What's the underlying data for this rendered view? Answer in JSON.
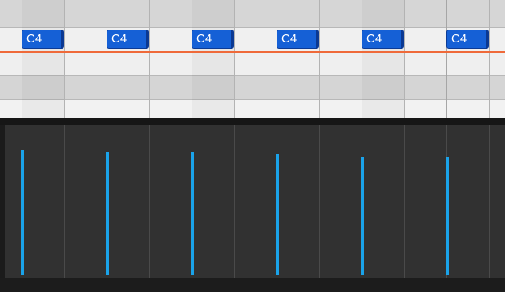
{
  "piano_roll": {
    "row_count": 5,
    "notes": [
      {
        "label": "C4",
        "velocity": 1.0
      },
      {
        "label": "C4",
        "velocity": 0.99
      },
      {
        "label": "C4",
        "velocity": 0.99
      },
      {
        "label": "C4",
        "velocity": 0.97
      },
      {
        "label": "C4",
        "velocity": 0.95
      },
      {
        "label": "C4",
        "velocity": 0.95
      }
    ]
  },
  "colors": {
    "note_fill": "#1560d6",
    "note_text": "#ffffff",
    "playhead": "#ef6a3a",
    "velocity_stem": "#1aa3ea",
    "velocity_background": "#313131"
  }
}
